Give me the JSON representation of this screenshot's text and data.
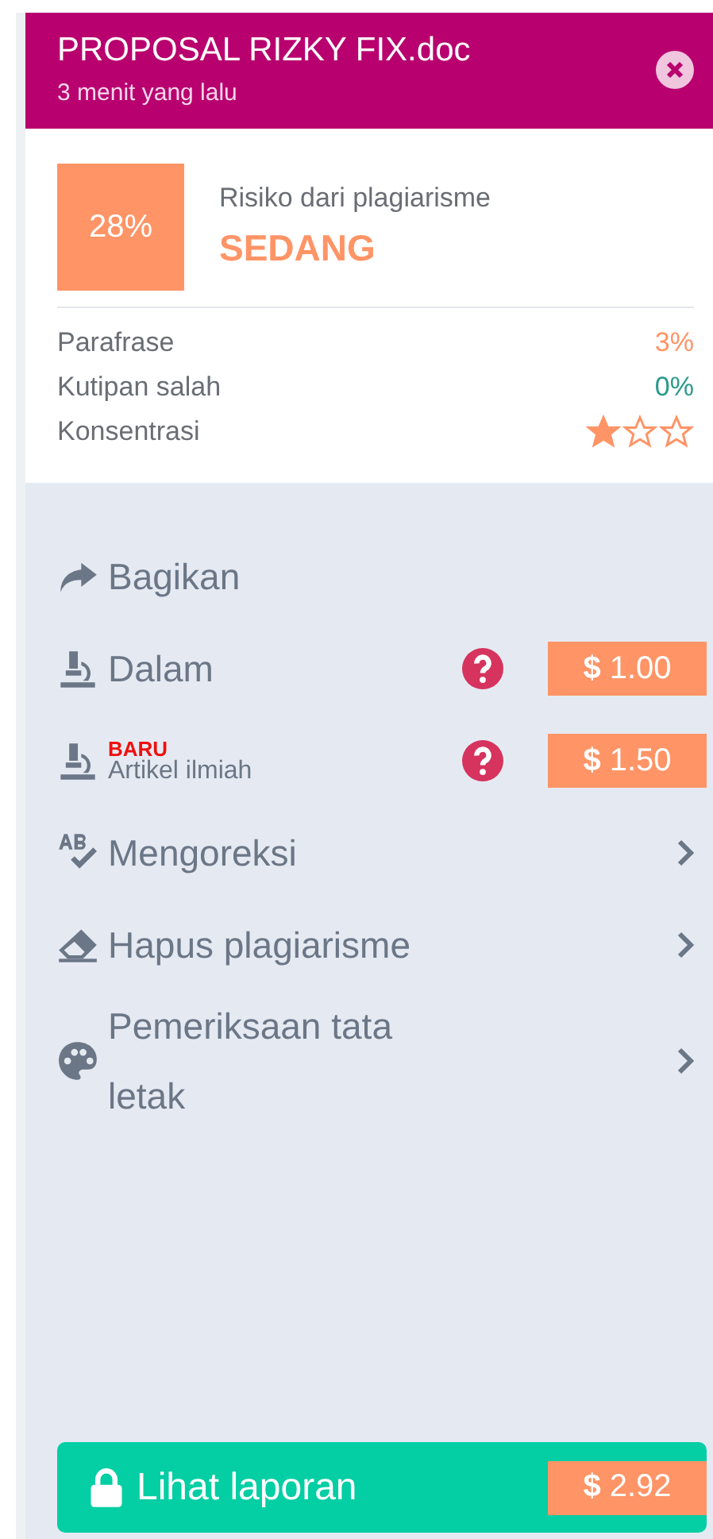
{
  "header": {
    "title": "PROPOSAL RIZKY FIX.doc",
    "subtitle": "3 menit yang lalu"
  },
  "risk": {
    "percent": "28%",
    "label": "Risiko dari plagiarisme",
    "level_text": "SEDANG",
    "color": "#ff9466"
  },
  "stats": [
    {
      "label": "Parafrase",
      "kind": "value",
      "value": "3%",
      "color": "#ff9466"
    },
    {
      "label": "Kutipan salah",
      "kind": "value",
      "value": "0%",
      "color": "#2a9a8a"
    },
    {
      "label": "Konsentrasi",
      "kind": "stars",
      "stars": 1
    }
  ],
  "menu": [
    {
      "kind": "plain",
      "label": "Bagikan"
    },
    {
      "kind": "priced",
      "label": "Dalam",
      "price": "**$** 1.00"
    },
    {
      "kind": "priced",
      "label": "Artikel ilmiah",
      "badge": "BARU",
      "price": "**$** 1.50"
    },
    {
      "kind": "submenu",
      "label": "Mengoreksi"
    },
    {
      "kind": "submenu",
      "label": "Hapus plagiarisme"
    },
    {
      "kind": "submenu",
      "label": "Pemeriksaan tata letak"
    }
  ],
  "report_button": {
    "label": "Lihat laporan",
    "price": "**$** 2.92"
  }
}
